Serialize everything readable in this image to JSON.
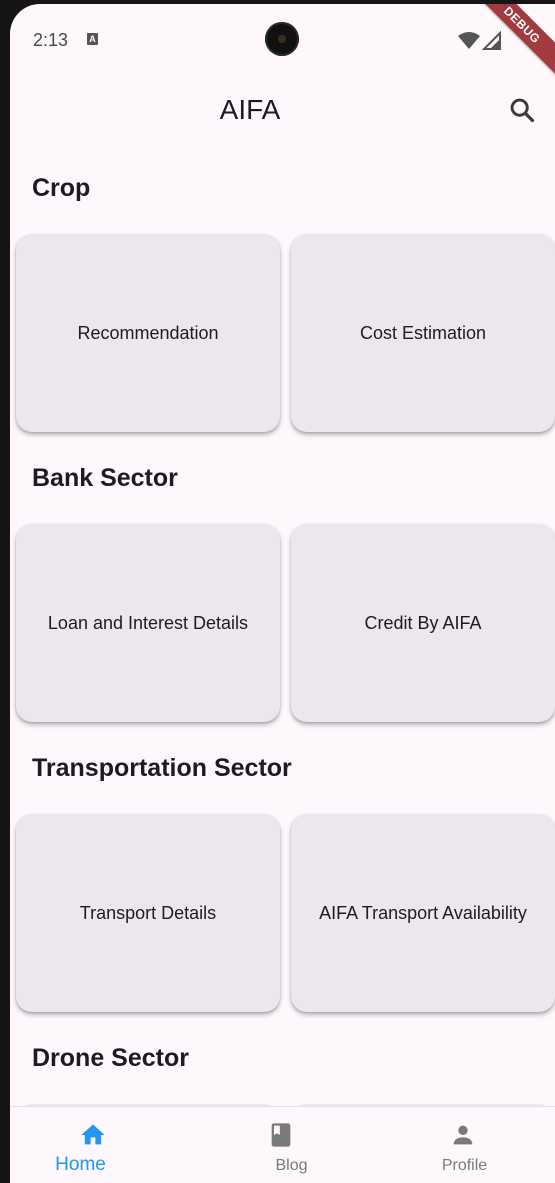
{
  "status_bar": {
    "time": "2:13",
    "notification_glyph": "A",
    "debug_banner": "DEBUG"
  },
  "app_bar": {
    "title": "AIFA"
  },
  "sections": [
    {
      "title": "Crop",
      "cards": [
        "Recommendation",
        "Cost Estimation"
      ]
    },
    {
      "title": "Bank Sector",
      "cards": [
        "Loan and Interest Details",
        "Credit By AIFA"
      ]
    },
    {
      "title": "Transportation Sector",
      "cards": [
        "Transport Details",
        "AIFA Transport Availability"
      ]
    },
    {
      "title": "Drone Sector",
      "cards": []
    }
  ],
  "bottom_nav": [
    {
      "label": "Home",
      "icon": "home-icon",
      "active": true
    },
    {
      "label": "Blog",
      "icon": "book-icon",
      "active": false
    },
    {
      "label": "Profile",
      "icon": "person-icon",
      "active": false
    }
  ],
  "colors": {
    "active": "#2196f3",
    "inactive": "#7a7a7a",
    "card": "#ece6ef",
    "background": "#fef7fb"
  }
}
